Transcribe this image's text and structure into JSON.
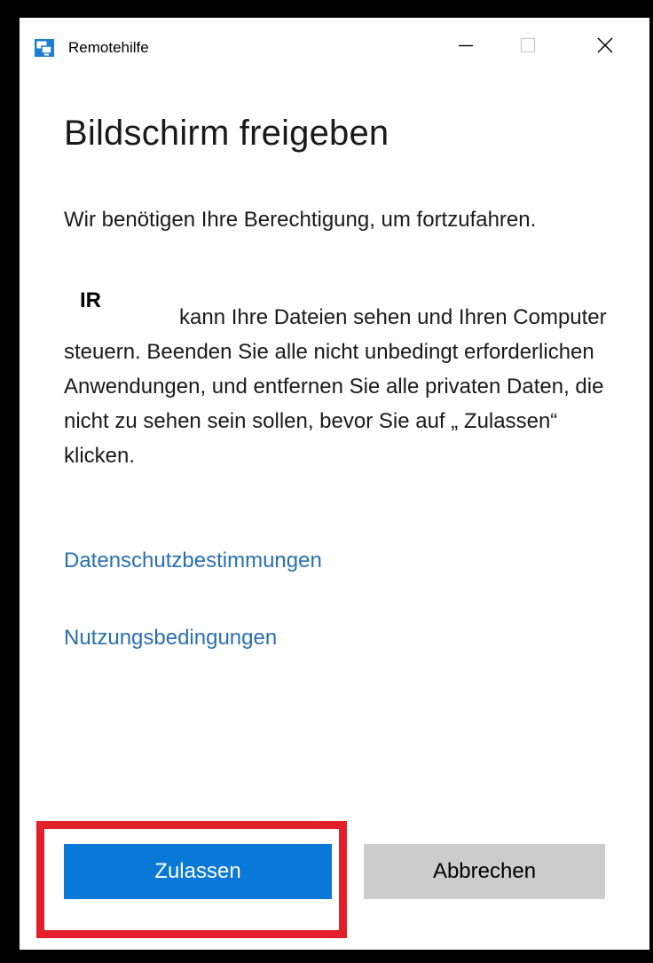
{
  "window": {
    "title": "Remotehilfe",
    "controls": {
      "minimize_icon": "minimize-icon",
      "maximize_icon": "maximize-icon",
      "close_icon": "close-icon"
    },
    "app_icon": "remote-assistance-icon"
  },
  "dialog": {
    "heading": "Bildschirm freigeben",
    "intro": "Wir benötigen Ihre Berechtigung, um fortzufahren.",
    "helper_name": "IR",
    "body": "kann Ihre Dateien sehen und Ihren Computer steuern. Beenden Sie alle nicht unbedingt erforderlichen Anwendungen, und entfernen Sie alle privaten Daten, die nicht zu sehen sein sollen, bevor Sie auf „ Zulassen“ klicken.",
    "links": {
      "privacy": "Datenschutzbestimmungen",
      "terms": "Nutzungsbedingungen"
    },
    "buttons": {
      "allow": "Zulassen",
      "cancel": "Abbrechen"
    }
  },
  "colors": {
    "accent": "#0a78d7",
    "link": "#2a6fb0",
    "highlight": "#e3202a",
    "cancel_bg": "#cccccc"
  }
}
